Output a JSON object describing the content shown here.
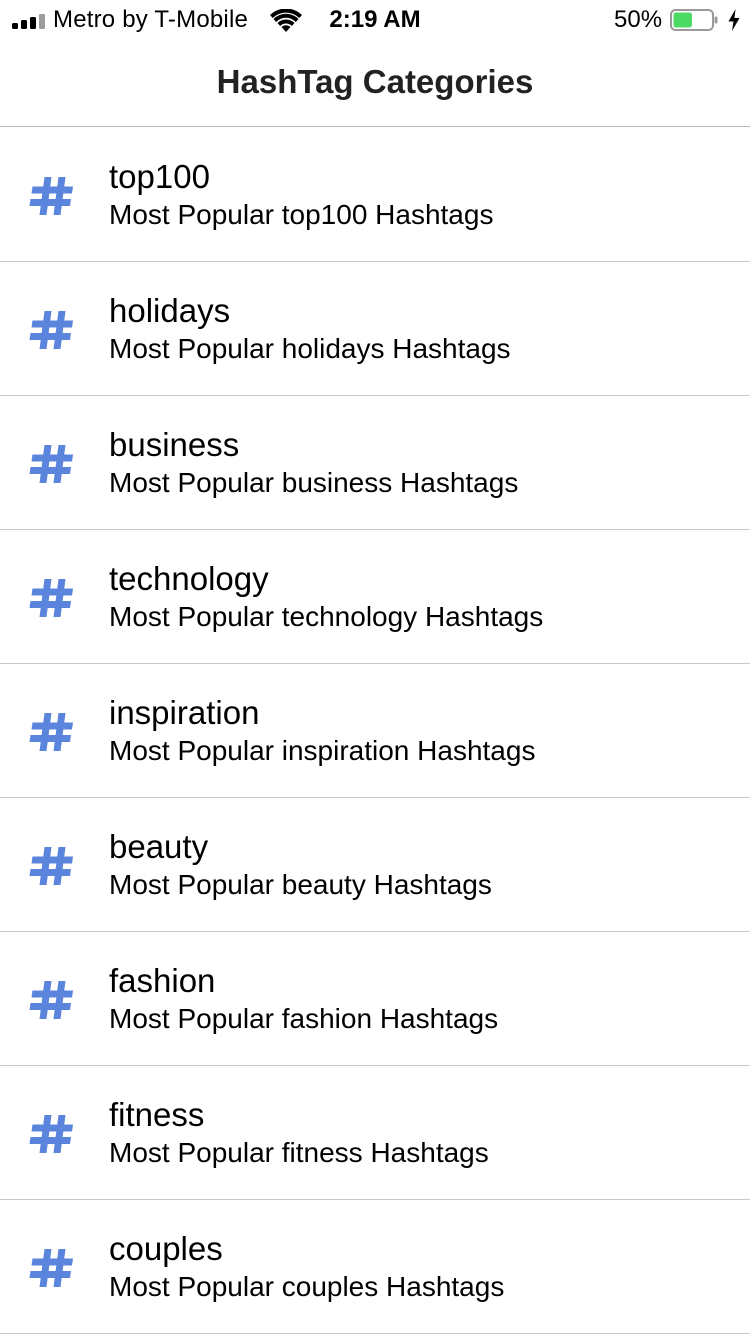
{
  "status_bar": {
    "carrier": "Metro by T-Mobile",
    "time": "2:19 AM",
    "battery_percent_label": "50%",
    "battery_level": 0.5,
    "battery_color": "#4cd964",
    "signal_bars_filled": 3,
    "signal_bars_total": 4
  },
  "nav": {
    "title": "HashTag Categories"
  },
  "accent_color": "#5b84dc",
  "icon": "hash-icon",
  "categories": [
    {
      "title": "top100",
      "subtitle": "Most Popular top100 Hashtags"
    },
    {
      "title": "holidays",
      "subtitle": "Most Popular holidays Hashtags"
    },
    {
      "title": "business",
      "subtitle": "Most Popular business Hashtags"
    },
    {
      "title": "technology",
      "subtitle": "Most Popular technology Hashtags"
    },
    {
      "title": "inspiration",
      "subtitle": "Most Popular inspiration Hashtags"
    },
    {
      "title": "beauty",
      "subtitle": "Most Popular beauty Hashtags"
    },
    {
      "title": "fashion",
      "subtitle": "Most Popular fashion Hashtags"
    },
    {
      "title": "fitness",
      "subtitle": "Most Popular fitness Hashtags"
    },
    {
      "title": "couples",
      "subtitle": "Most Popular couples Hashtags"
    }
  ]
}
